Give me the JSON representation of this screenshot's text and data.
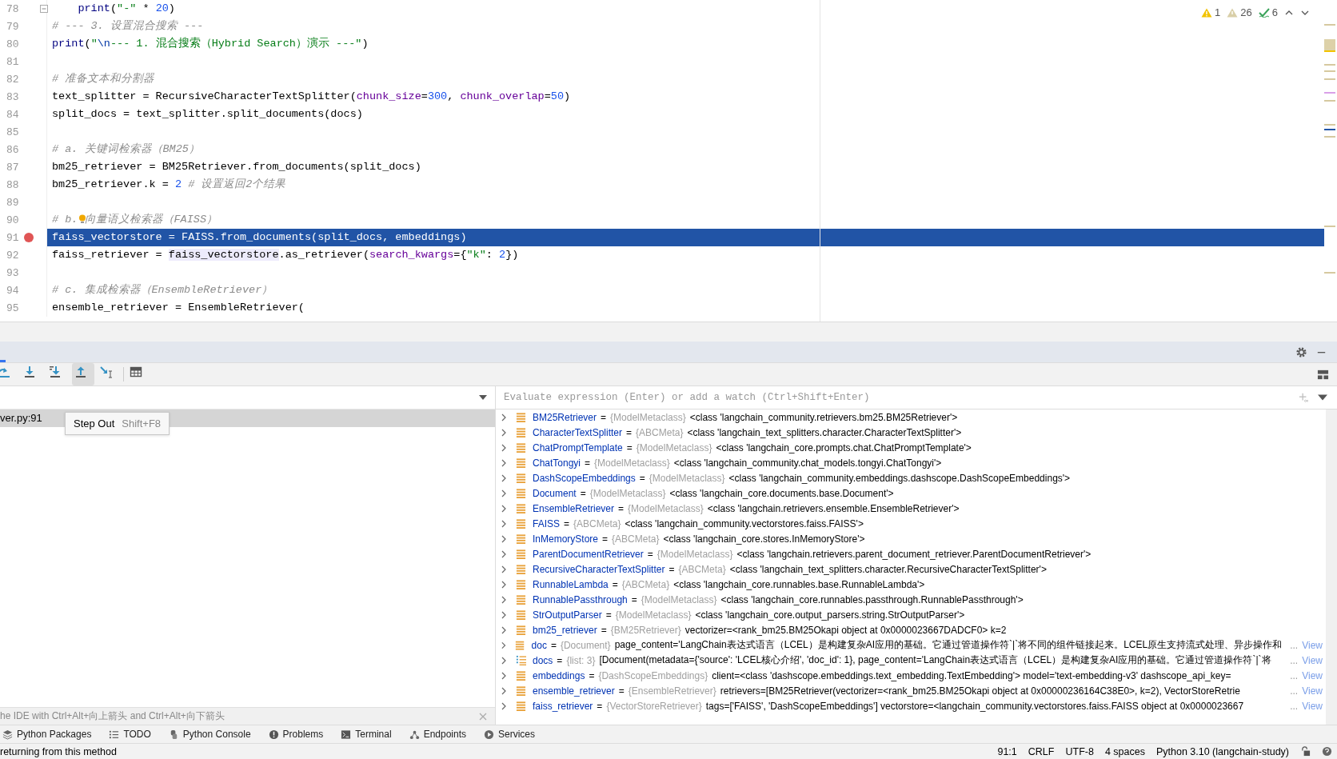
{
  "editor": {
    "lines": [
      {
        "number": "78",
        "fold": true,
        "breakpoint": false,
        "current": false,
        "bulb": false,
        "tokens": [
          {
            "kind": "builtin",
            "text": "    print"
          },
          {
            "kind": "plain",
            "text": "("
          },
          {
            "kind": "string",
            "text": "\"-\""
          },
          {
            "kind": "plain",
            "text": " * "
          },
          {
            "kind": "number",
            "text": "20"
          },
          {
            "kind": "plain",
            "text": ")"
          }
        ]
      },
      {
        "number": "79",
        "fold": false,
        "breakpoint": false,
        "current": false,
        "bulb": false,
        "tokens": [
          {
            "kind": "comment",
            "text": "# --- 3. 设置混合搜索 ---"
          }
        ]
      },
      {
        "number": "80",
        "fold": false,
        "breakpoint": false,
        "current": false,
        "bulb": false,
        "tokens": [
          {
            "kind": "builtin",
            "text": "print"
          },
          {
            "kind": "plain",
            "text": "("
          },
          {
            "kind": "string",
            "text": "\""
          },
          {
            "kind": "escape",
            "text": "\\n"
          },
          {
            "kind": "string",
            "text": "--- 1. 混合搜索（Hybrid Search）演示 ---\""
          },
          {
            "kind": "plain",
            "text": ")"
          }
        ]
      },
      {
        "number": "81",
        "fold": false,
        "breakpoint": false,
        "current": false,
        "bulb": false
      },
      {
        "number": "82",
        "fold": false,
        "breakpoint": false,
        "current": false,
        "bulb": false,
        "tokens": [
          {
            "kind": "comment",
            "text": "# 准备文本和分割器"
          }
        ]
      },
      {
        "number": "83",
        "fold": false,
        "breakpoint": false,
        "current": false,
        "bulb": false,
        "tokens": [
          {
            "kind": "plain",
            "text": "text_splitter = RecursiveCharacterTextSplitter("
          },
          {
            "kind": "param",
            "text": "chunk_size"
          },
          {
            "kind": "plain",
            "text": "="
          },
          {
            "kind": "number",
            "text": "300"
          },
          {
            "kind": "plain",
            "text": ", "
          },
          {
            "kind": "param",
            "text": "chunk_overlap"
          },
          {
            "kind": "plain",
            "text": "="
          },
          {
            "kind": "number",
            "text": "50"
          },
          {
            "kind": "plain",
            "text": ")"
          }
        ]
      },
      {
        "number": "84",
        "fold": false,
        "breakpoint": false,
        "current": false,
        "bulb": false,
        "tokens": [
          {
            "kind": "plain",
            "text": "split_docs = text_splitter.split_documents(docs)"
          }
        ]
      },
      {
        "number": "85",
        "fold": false,
        "breakpoint": false,
        "current": false,
        "bulb": false
      },
      {
        "number": "86",
        "fold": false,
        "breakpoint": false,
        "current": false,
        "bulb": false,
        "tokens": [
          {
            "kind": "comment",
            "text": "# a. 关键词检索器（BM25）"
          }
        ]
      },
      {
        "number": "87",
        "fold": false,
        "breakpoint": false,
        "current": false,
        "bulb": false,
        "tokens": [
          {
            "kind": "plain",
            "text": "bm25_retriever = BM25Retriever.from_documents(split_docs)"
          }
        ]
      },
      {
        "number": "88",
        "fold": false,
        "breakpoint": false,
        "current": false,
        "bulb": false,
        "tokens": [
          {
            "kind": "plain",
            "text": "bm25_retriever.k = "
          },
          {
            "kind": "number",
            "text": "2"
          },
          {
            "kind": "comment",
            "text": " # 设置返回2个结果"
          }
        ]
      },
      {
        "number": "89",
        "fold": false,
        "breakpoint": false,
        "current": false,
        "bulb": false
      },
      {
        "number": "90",
        "fold": false,
        "breakpoint": false,
        "current": false,
        "bulb": true,
        "tokens": [
          {
            "kind": "comment",
            "text": "# b. 向量语义检索器（FAISS）"
          }
        ]
      },
      {
        "number": "91",
        "fold": false,
        "breakpoint": true,
        "current": true,
        "bulb": false,
        "tokens": [
          {
            "kind": "plain",
            "text": "faiss_vectorstore = FAISS.from_documents(split_docs, embeddings)"
          }
        ]
      },
      {
        "number": "92",
        "fold": false,
        "breakpoint": false,
        "current": false,
        "bulb": false,
        "tokens": [
          {
            "kind": "plain",
            "text": "faiss_retriever = "
          },
          {
            "kind": "usage",
            "text": "faiss_vectorstore"
          },
          {
            "kind": "plain",
            "text": ".as_retriever("
          },
          {
            "kind": "param",
            "text": "search_kwargs"
          },
          {
            "kind": "plain",
            "text": "={"
          },
          {
            "kind": "string",
            "text": "\"k\""
          },
          {
            "kind": "plain",
            "text": ": "
          },
          {
            "kind": "number",
            "text": "2"
          },
          {
            "kind": "plain",
            "text": "})"
          }
        ]
      },
      {
        "number": "93",
        "fold": false,
        "breakpoint": false,
        "current": false,
        "bulb": false
      },
      {
        "number": "94",
        "fold": false,
        "breakpoint": false,
        "current": false,
        "bulb": false,
        "tokens": [
          {
            "kind": "comment",
            "text": "# c. 集成检索器（EnsembleRetriever）"
          }
        ]
      },
      {
        "number": "95",
        "fold": false,
        "breakpoint": false,
        "current": false,
        "bulb": false,
        "tokens": [
          {
            "kind": "plain",
            "text": "ensemble_retriever = EnsembleRetriever("
          }
        ]
      }
    ],
    "inspections": [
      {
        "kind": "warning",
        "count": "1"
      },
      {
        "kind": "weak-warning",
        "count": "26"
      },
      {
        "kind": "typo",
        "count": "6"
      }
    ]
  },
  "debugger": {
    "toolbar": [
      {
        "kind": "step-over",
        "selected": false
      },
      {
        "kind": "step-into",
        "selected": false
      },
      {
        "kind": "step-into-my-code",
        "selected": false
      },
      {
        "kind": "step-out",
        "selected": true
      },
      {
        "kind": "run-to-cursor",
        "selected": false
      },
      {
        "kind": "table",
        "selected": false
      }
    ],
    "tooltip": {
      "title": "Step Out",
      "shortcut": "Shift+F8"
    },
    "frames": [
      {
        "label": "ver.py:91",
        "selected": true
      }
    ],
    "hint": "he IDE with Ctrl+Alt+向上箭头 and Ctrl+Alt+向下箭头",
    "evaluate_placeholder": "Evaluate expression (Enter) or add a watch (Ctrl+Shift+Enter)",
    "variables": [
      {
        "kind": "object",
        "name": "BM25Retriever",
        "operator": "=",
        "type": "{ModelMetaclass}",
        "value": "<class 'langchain_community.retrievers.bm25.BM25Retriever'>"
      },
      {
        "kind": "object",
        "name": "CharacterTextSplitter",
        "operator": "=",
        "type": "{ABCMeta}",
        "value": "<class 'langchain_text_splitters.character.CharacterTextSplitter'>"
      },
      {
        "kind": "object",
        "name": "ChatPromptTemplate",
        "operator": "=",
        "type": "{ModelMetaclass}",
        "value": "<class 'langchain_core.prompts.chat.ChatPromptTemplate'>"
      },
      {
        "kind": "object",
        "name": "ChatTongyi",
        "operator": "=",
        "type": "{ModelMetaclass}",
        "value": "<class 'langchain_community.chat_models.tongyi.ChatTongyi'>"
      },
      {
        "kind": "object",
        "name": "DashScopeEmbeddings",
        "operator": "=",
        "type": "{ModelMetaclass}",
        "value": "<class 'langchain_community.embeddings.dashscope.DashScopeEmbeddings'>"
      },
      {
        "kind": "object",
        "name": "Document",
        "operator": "=",
        "type": "{ModelMetaclass}",
        "value": "<class 'langchain_core.documents.base.Document'>"
      },
      {
        "kind": "object",
        "name": "EnsembleRetriever",
        "operator": "=",
        "type": "{ModelMetaclass}",
        "value": "<class 'langchain.retrievers.ensemble.EnsembleRetriever'>"
      },
      {
        "kind": "object",
        "name": "FAISS",
        "operator": "=",
        "type": "{ABCMeta}",
        "value": "<class 'langchain_community.vectorstores.faiss.FAISS'>"
      },
      {
        "kind": "object",
        "name": "InMemoryStore",
        "operator": "=",
        "type": "{ABCMeta}",
        "value": "<class 'langchain_core.stores.InMemoryStore'>"
      },
      {
        "kind": "object",
        "name": "ParentDocumentRetriever",
        "operator": "=",
        "type": "{ModelMetaclass}",
        "value": "<class 'langchain.retrievers.parent_document_retriever.ParentDocumentRetriever'>"
      },
      {
        "kind": "object",
        "name": "RecursiveCharacterTextSplitter",
        "operator": "=",
        "type": "{ABCMeta}",
        "value": "<class 'langchain_text_splitters.character.RecursiveCharacterTextSplitter'>"
      },
      {
        "kind": "object",
        "name": "RunnableLambda",
        "operator": "=",
        "type": "{ABCMeta}",
        "value": "<class 'langchain_core.runnables.base.RunnableLambda'>"
      },
      {
        "kind": "object",
        "name": "RunnablePassthrough",
        "operator": "=",
        "type": "{ModelMetaclass}",
        "value": "<class 'langchain_core.runnables.passthrough.RunnablePassthrough'>"
      },
      {
        "kind": "object",
        "name": "StrOutputParser",
        "operator": "=",
        "type": "{ModelMetaclass}",
        "value": "<class 'langchain_core.output_parsers.string.StrOutputParser'>"
      },
      {
        "kind": "object",
        "name": "bm25_retriever",
        "operator": "=",
        "type": "{BM25Retriever}",
        "value": "vectorizer=<rank_bm25.BM25Okapi object at 0x0000023667DADCF0> k=2"
      },
      {
        "kind": "object",
        "name": "doc",
        "operator": "=",
        "type": "{Document}",
        "value": "page_content='LangChain表达式语言（LCEL）是构建复杂AI应用的基础。它通过管道操作符`|`将不同的组件链接起来。LCEL原生支持流式处理、异步操作和",
        "more": "...",
        "view": "View"
      },
      {
        "kind": "list",
        "name": "docs",
        "operator": "=",
        "type": "{list: 3}",
        "value": "[Document(metadata={'source': 'LCEL核心介绍', 'doc_id': 1}, page_content='LangChain表达式语言（LCEL）是构建复杂AI应用的基础。它通过管道操作符`|`将",
        "more": "...",
        "view": "View"
      },
      {
        "kind": "object",
        "name": "embeddings",
        "operator": "=",
        "type": "{DashScopeEmbeddings}",
        "value": "client=<class 'dashscope.embeddings.text_embedding.TextEmbedding'> model='text-embedding-v3' dashscope_api_key=",
        "more": "...",
        "view": "View"
      },
      {
        "kind": "object",
        "name": "ensemble_retriever",
        "operator": "=",
        "type": "{EnsembleRetriever}",
        "value": "retrievers=[BM25Retriever(vectorizer=<rank_bm25.BM25Okapi object at 0x00000236164C38E0>, k=2), VectorStoreRetrie",
        "more": "...",
        "view": "View"
      },
      {
        "kind": "object",
        "name": "faiss_retriever",
        "operator": "=",
        "type": "{VectorStoreRetriever}",
        "value": "tags=['FAISS', 'DashScopeEmbeddings'] vectorstore=<langchain_community.vectorstores.faiss.FAISS object at 0x0000023667",
        "more": "...",
        "view": "View"
      }
    ]
  },
  "tool_tabs": [
    {
      "kind": "packages",
      "label": "Python Packages"
    },
    {
      "kind": "todo",
      "label": "TODO"
    },
    {
      "kind": "console",
      "label": "Python Console"
    },
    {
      "kind": "problems",
      "label": "Problems"
    },
    {
      "kind": "terminal",
      "label": "Terminal"
    },
    {
      "kind": "endpoints",
      "label": "Endpoints"
    },
    {
      "kind": "services",
      "label": "Services"
    }
  ],
  "status_bar": {
    "message": "returning from this method",
    "items": [
      "91:1",
      "CRLF",
      "UTF-8",
      "4 spaces",
      "Python 3.10 (langchain-study)"
    ]
  }
}
